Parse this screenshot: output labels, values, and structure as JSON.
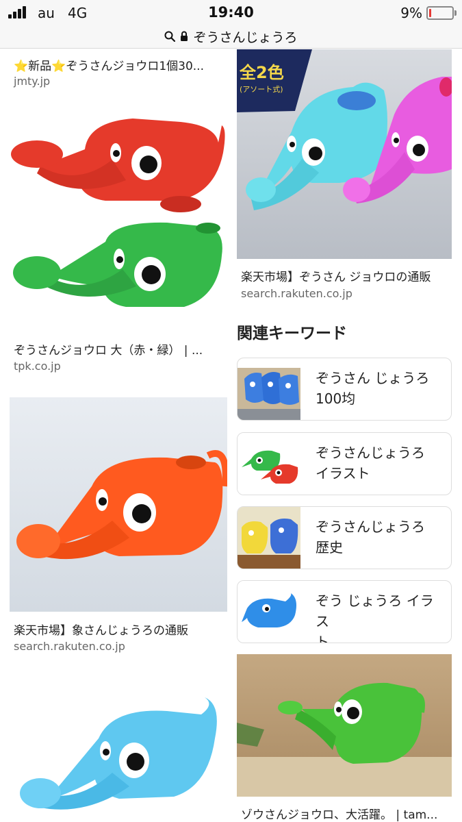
{
  "status_bar": {
    "carrier": "au",
    "network": "4G",
    "time": "19:40",
    "battery_percent": "9%",
    "battery_level": 0.09
  },
  "url_bar": {
    "query": "ぞうさんじょうろ"
  },
  "results": [
    {
      "caption": "⭐新品⭐ぞうさんジョウロ1個30...",
      "source": "jmty.jp",
      "image": "elephant-watering-can"
    },
    {
      "caption": "ぞうさんジョウロ 大（赤・緑） | ...",
      "source": "tpk.co.jp",
      "image": "red-and-green-elephant-watering-cans"
    },
    {
      "caption": "楽天市場】象さんじょうろの通販",
      "source": "search.rakuten.co.jp",
      "image": "orange-elephant-watering-can"
    },
    {
      "caption": "",
      "source": "",
      "image": "light-blue-elephant-watering-can"
    },
    {
      "caption": "楽天市場】ぞうさん ジョウロの通販",
      "source": "search.rakuten.co.jp",
      "image": "blue-and-pink-elephant-watering-cans",
      "banner_text": "全2色",
      "banner_sub": "(アソート式)"
    },
    {
      "caption": "ゾウさんジョウロ、大活躍。 | tam...",
      "source": "",
      "image": "green-elephant-watering-can"
    }
  ],
  "related": {
    "heading": "関連キーワード",
    "items": [
      {
        "label": "ぞうさん じょうろ\n100均",
        "image": "blue-elephant-cans-on-shelf"
      },
      {
        "label": "ぞうさんじょうろ\nイラスト",
        "image": "green-and-red-elephant-illustration"
      },
      {
        "label": "ぞうさんじょうろ\n歴史",
        "image": "yellow-and-blue-elephant-cans"
      },
      {
        "label": "ぞう じょうろ イラス\nト",
        "image": "blue-elephant-illustration"
      }
    ]
  },
  "colors": {
    "red": "#e53a2b",
    "green": "#35b94a",
    "orange": "#ff5a1f",
    "light_blue": "#5fc8f0",
    "pink": "#e85ce0",
    "cyan": "#62d9e8"
  }
}
